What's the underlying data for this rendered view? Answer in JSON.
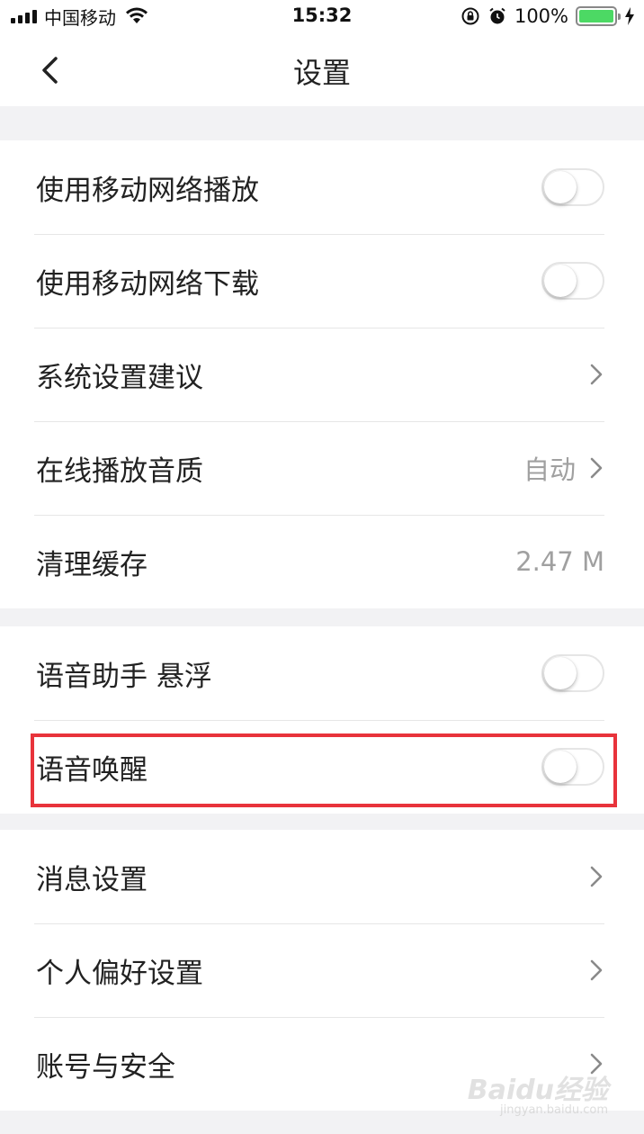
{
  "status_bar": {
    "carrier": "中国移动",
    "time": "15:32",
    "battery": "100%",
    "icons": [
      "signal-icon",
      "wifi-icon",
      "orientation-lock-icon",
      "alarm-icon",
      "battery-icon",
      "charging-icon"
    ]
  },
  "nav": {
    "title": "设置",
    "back_icon": "chevron-left-icon"
  },
  "sections": [
    {
      "items": [
        {
          "label": "使用移动网络播放",
          "control": "toggle",
          "on": false
        },
        {
          "label": "使用移动网络下载",
          "control": "toggle",
          "on": false
        },
        {
          "label": "系统设置建议",
          "control": "chevron"
        },
        {
          "label": "在线播放音质",
          "control": "chevron",
          "value": "自动"
        },
        {
          "label": "清理缓存",
          "control": "value",
          "value": "2.47 M"
        }
      ]
    },
    {
      "items": [
        {
          "label": "语音助手 悬浮",
          "control": "toggle",
          "on": false
        },
        {
          "label": "语音唤醒",
          "control": "toggle",
          "on": false,
          "highlighted": true
        }
      ]
    },
    {
      "items": [
        {
          "label": "消息设置",
          "control": "chevron"
        },
        {
          "label": "个人偏好设置",
          "control": "chevron"
        },
        {
          "label": "账号与安全",
          "control": "chevron"
        }
      ]
    }
  ],
  "colors": {
    "background": "#f2f2f4",
    "highlight_border": "#e8333b",
    "battery_fill": "#4cd964",
    "secondary_text": "#a0a0a0"
  },
  "watermark": {
    "text": "Baidu经验",
    "sub": "jingyan.baidu.com"
  }
}
